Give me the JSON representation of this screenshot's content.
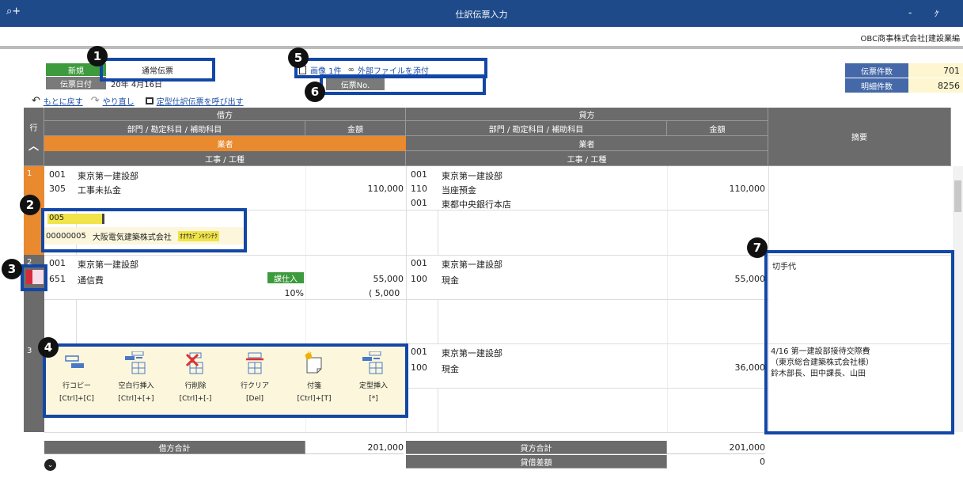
{
  "window": {
    "title": "仕訳伝票入力",
    "search_glyph": "⌕+",
    "minimize": "‐",
    "restore": "ｹ"
  },
  "company": "OBC商事株式会社[建設業編",
  "header": {
    "new_label": "新規",
    "voucher_type": "通常伝票",
    "date_label": "伝票日付",
    "date_value": "20年 4月16日",
    "image_text": "画像 1件",
    "attach_text": "外部ファイルを添付",
    "voucher_no_label": "伝票No.",
    "voucher_no_value": "",
    "count_label": "伝票件数",
    "count_value": "701",
    "detail_label": "明細件数",
    "detail_value": "8256"
  },
  "undo_bar": {
    "undo": "もとに戻す",
    "redo": "やり直し",
    "template": "定型仕訳伝票を呼び出す"
  },
  "columns": {
    "row": "行",
    "debit": "借方",
    "credit": "貸方",
    "dept_account": "部門 / 勘定科目 / 補助科目",
    "amount": "金額",
    "vendor": "業者",
    "construction": "工事 / 工種",
    "summary": "摘要"
  },
  "rows": [
    {
      "num": "1",
      "d_dept_code": "001",
      "d_dept": "東京第一建設部",
      "d_acct_code": "305",
      "d_acct": "工事未払金",
      "d_amount": "110,000",
      "c_dept_code": "001",
      "c_dept": "東京第一建設部",
      "c_acct_code": "110",
      "c_acct": "当座預金",
      "c_sub_code": "001",
      "c_sub": "東都中央銀行本店",
      "c_amount": "110,000",
      "vendor_input": "005",
      "vendor_code": "00000005",
      "vendor_name": "大阪電気建築株式会社",
      "vendor_kana": "ｵｵｻｶﾃﾞﾝｷｹﾝﾁｸ"
    },
    {
      "num": "2",
      "d_dept_code": "001",
      "d_dept": "東京第一建設部",
      "d_acct_code": "651",
      "d_acct": "通信費",
      "d_tax": "課仕入",
      "d_rate": "10%",
      "d_amount": "55,000",
      "d_tax_amount": "( 5,000",
      "c_dept_code": "001",
      "c_dept": "東京第一建設部",
      "c_acct_code": "100",
      "c_acct": "現金",
      "c_amount": "55,000",
      "summary": "切手代"
    },
    {
      "num": "3",
      "c_dept_code": "001",
      "c_dept": "東京第一建設部",
      "c_acct_code": "100",
      "c_acct": "現金",
      "c_amount": "36,000",
      "summary": "4/16 第一建設部接待交際費\n（東京総合建築株式会社様）\n鈴木部長、田中課長、山田"
    }
  ],
  "toolbar": [
    {
      "label": "行コピー",
      "key": "[Ctrl]+[C]",
      "icon": "row-copy-icon"
    },
    {
      "label": "空白行挿入",
      "key": "[Ctrl]+[+]",
      "icon": "insert-blank-row-icon"
    },
    {
      "label": "行削除",
      "key": "[Ctrl]+[-]",
      "icon": "row-delete-icon"
    },
    {
      "label": "行クリア",
      "key": "[Del]",
      "icon": "row-clear-icon"
    },
    {
      "label": "付箋",
      "key": "[Ctrl]+[T]",
      "icon": "sticky-note-icon"
    },
    {
      "label": "定型挿入",
      "key": "[*]",
      "icon": "template-insert-icon"
    }
  ],
  "totals": {
    "debit_label": "借方合計",
    "debit_value": "201,000",
    "credit_label": "貸方合計",
    "credit_value": "201,000",
    "diff_label": "貸借差額",
    "diff_value": "0"
  },
  "callouts": [
    "1",
    "2",
    "3",
    "4",
    "5",
    "6",
    "7"
  ],
  "colors": {
    "title_bar": "#1e4a8a",
    "orange": "#e98a2e",
    "frame": "#1347a6",
    "green": "#3d9a3d"
  }
}
